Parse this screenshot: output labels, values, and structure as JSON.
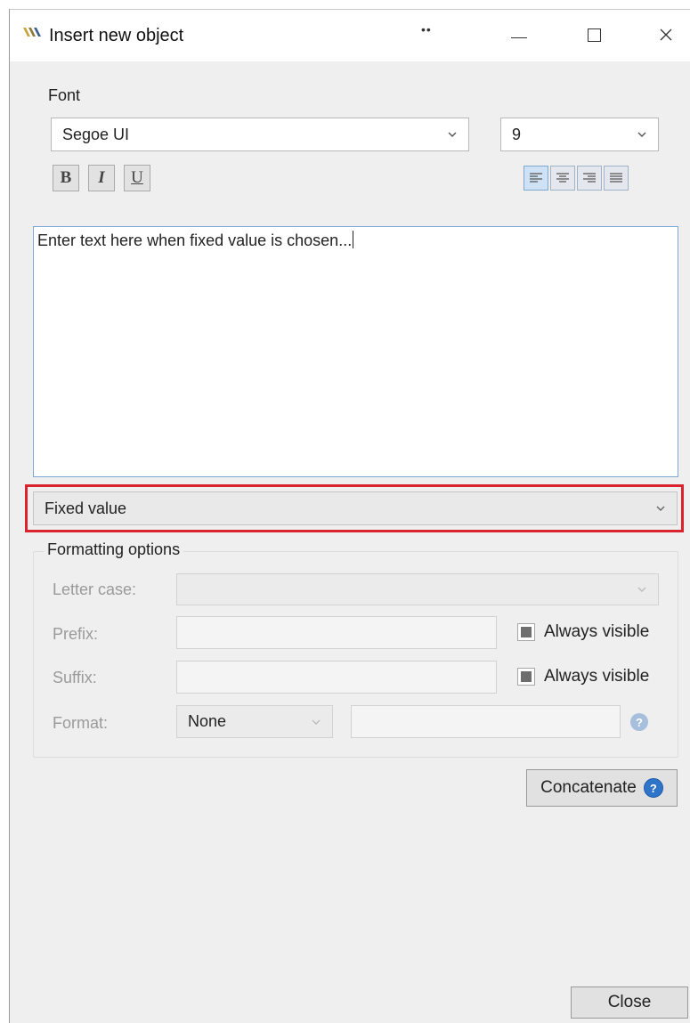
{
  "window": {
    "title": "Insert new object",
    "grip": "••",
    "icon": "app-logo-icon",
    "controls": {
      "minimize": "minimize-icon",
      "maximize": "maximize-icon",
      "close": "close-icon"
    }
  },
  "font": {
    "section_label": "Font",
    "family": "Segoe UI",
    "size": "9",
    "bold_label": "B",
    "italic_label": "I",
    "underline_label": "U",
    "alignments": [
      "align-left",
      "align-center",
      "align-right",
      "align-justify"
    ],
    "active_alignment": "align-left"
  },
  "text_input": {
    "value": "Enter text here when fixed value is chosen..."
  },
  "source_select": {
    "value": "Fixed value",
    "highlight_color": "#d9232f"
  },
  "formatting": {
    "section_label": "Formatting options",
    "letter_case_label": "Letter case:",
    "letter_case_value": "",
    "prefix_label": "Prefix:",
    "prefix_value": "",
    "prefix_always_visible": "Always visible",
    "suffix_label": "Suffix:",
    "suffix_value": "",
    "suffix_always_visible": "Always visible",
    "format_label": "Format:",
    "format_value": "None",
    "format_text": ""
  },
  "buttons": {
    "concatenate": "Concatenate",
    "close": "Close"
  },
  "colors": {
    "accent": "#2e75c9",
    "window_bg": "#efefef"
  }
}
